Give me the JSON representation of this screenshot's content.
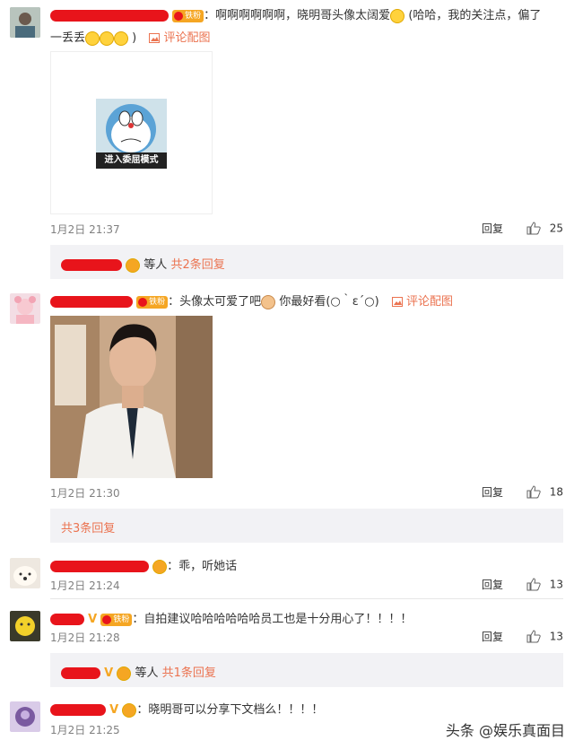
{
  "c1": {
    "text": "：啊啊啊啊啊啊，晓明哥头像太阔爱",
    "text2": "(哈哈，我的关注点，偏了",
    "text3": "一丢丢",
    "text4": ")",
    "badge": "铁粉",
    "pic_link": "评论配图",
    "image_caption": "进入委屈模式",
    "time": "1月2日 21:37",
    "reply": "回复",
    "likes": "25",
    "replybar_mid": "等人",
    "replybar_link": "共2条回复"
  },
  "c2": {
    "text": "：头像太可爱了吧",
    "text2": "你最好看(○｀ε´○)",
    "badge": "铁粉",
    "pic_link": "评论配图",
    "time": "1月2日 21:30",
    "reply": "回复",
    "likes": "18",
    "replybar_link": "共3条回复"
  },
  "c3": {
    "text": "：乖，听她话",
    "time": "1月2日 21:24",
    "reply": "回复",
    "likes": "13"
  },
  "c4": {
    "text": "：自拍建议哈哈哈哈哈哈员工也是十分用心了！！！！",
    "badge": "铁粉",
    "time": "1月2日 21:28",
    "reply": "回复",
    "likes": "13",
    "replybar_mid": "等人",
    "replybar_link": "共1条回复"
  },
  "c5": {
    "text": "：晓明哥可以分享下文档么！！！！",
    "time": "1月2日 21:25"
  },
  "watermark": "头条 @娱乐真面目",
  "colors": {
    "link": "#eb7350",
    "redaction": "#e8141b",
    "badge": "#f5a623",
    "replybar": "#f2f2f5"
  }
}
